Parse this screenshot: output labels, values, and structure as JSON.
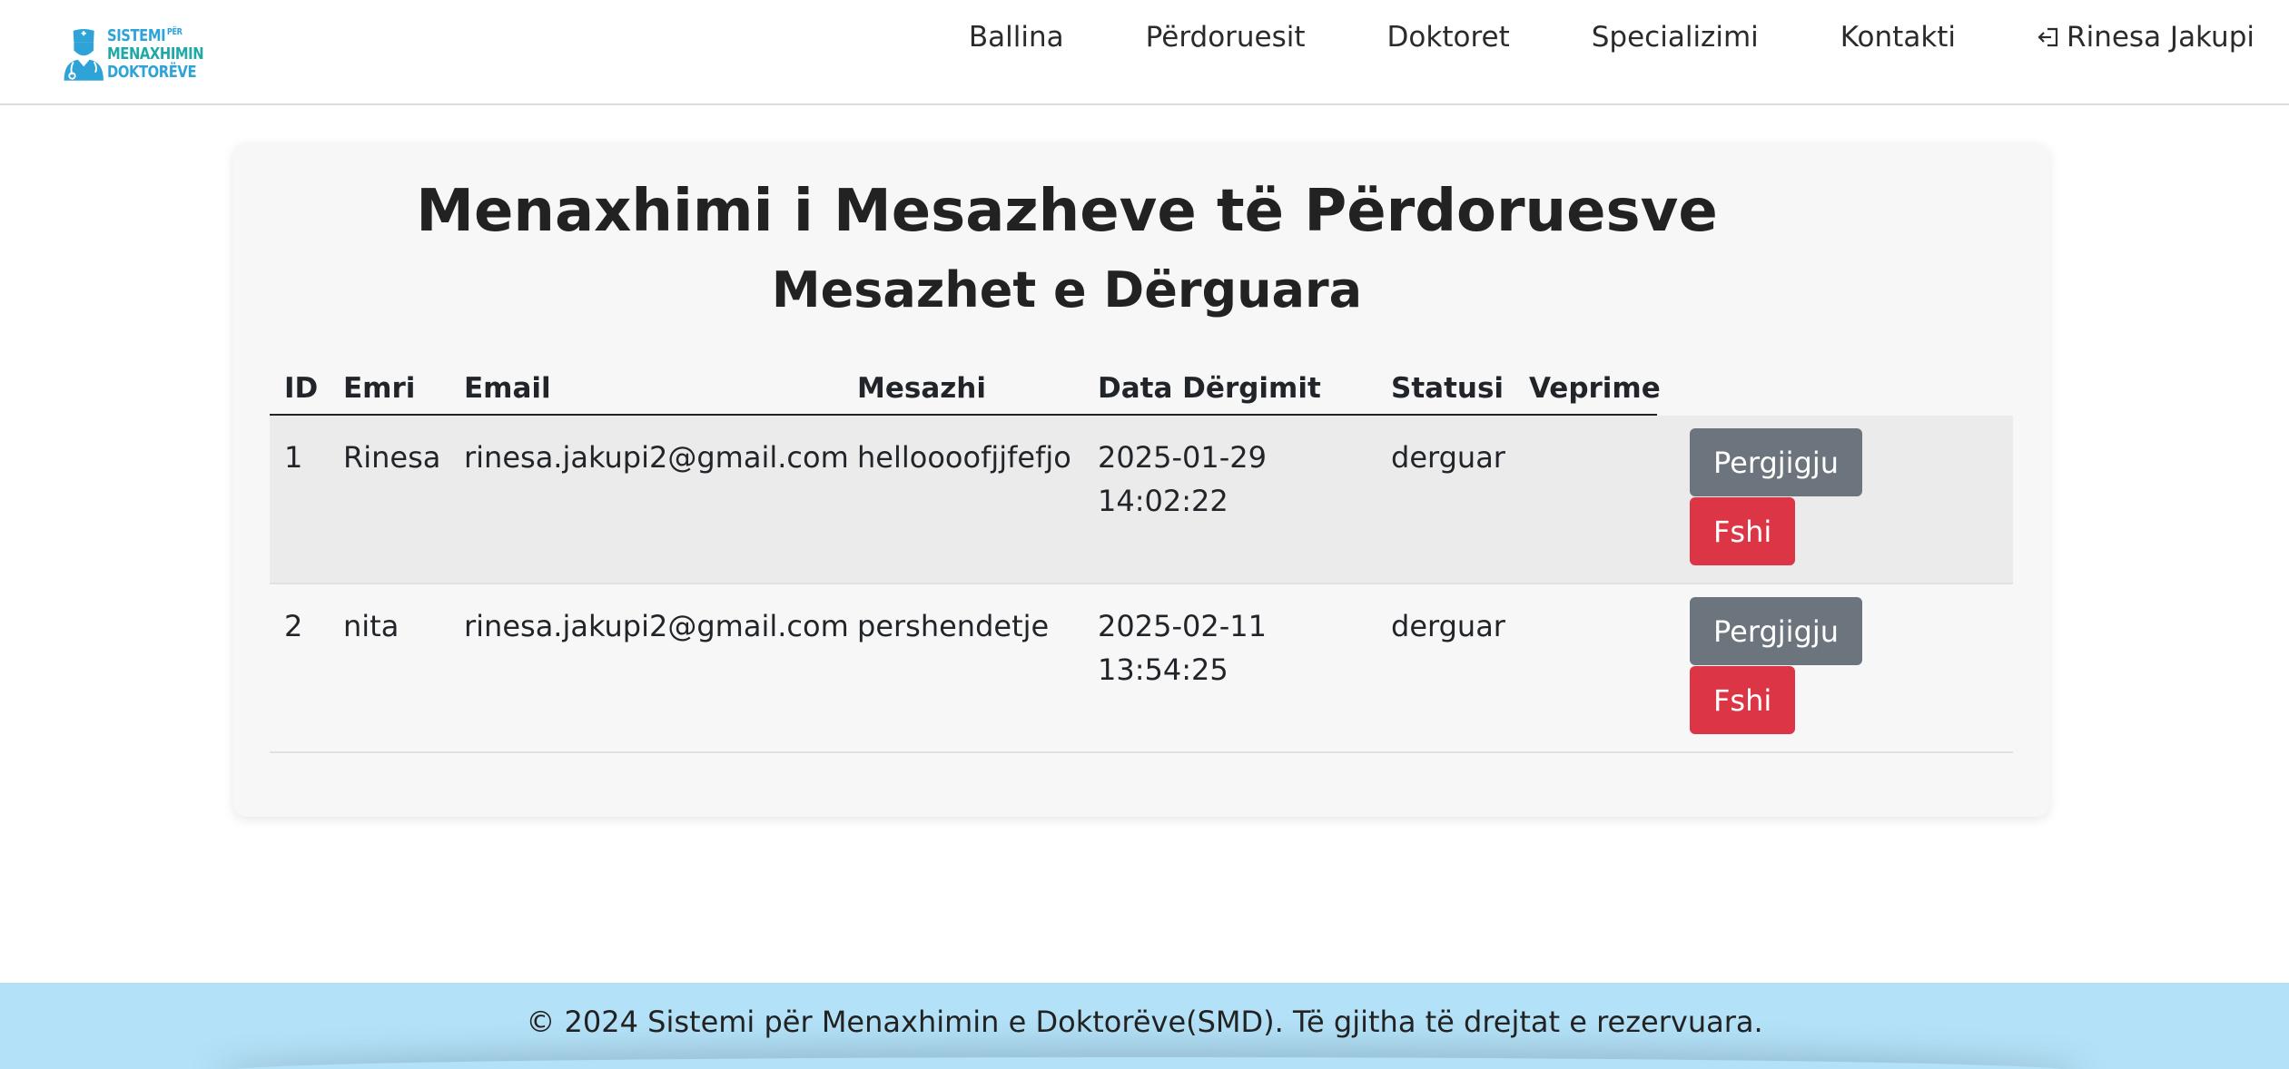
{
  "brand": {
    "line1": "SISTEMI",
    "line1_small": "PËR",
    "line2": "MENAXHIMIN",
    "line3": "DOKTORËVE",
    "icon": "doctor-avatar-icon",
    "colors": {
      "blue": "#2ea3d8",
      "teal": "#1ea9a8"
    }
  },
  "nav": {
    "items": [
      {
        "label": "Ballina"
      },
      {
        "label": "Përdoruesit"
      },
      {
        "label": "Doktoret"
      },
      {
        "label": "Specializimi"
      },
      {
        "label": "Kontakti"
      }
    ],
    "user": {
      "label": "Rinesa Jakupi",
      "icon": "logout-icon"
    }
  },
  "page": {
    "title": "Menaxhimi i Mesazheve të Përdoruesve",
    "section_title": "Mesazhet e Dërguara"
  },
  "table": {
    "headers": {
      "id": "ID",
      "name": "Emri",
      "email": "Email",
      "message": "Mesazhi",
      "date": "Data Dërgimit",
      "status": "Statusi",
      "actions": "Veprime"
    },
    "rows": [
      {
        "id": "1",
        "name": "Rinesa",
        "email": "rinesa.jakupi2@gmail.com",
        "message": "helloooofjjfefjo",
        "date": "2025-01-29",
        "time": "14:02:22",
        "status": "derguar",
        "reply_label": "Pergjigju",
        "delete_label": "Fshi"
      },
      {
        "id": "2",
        "name": "nita",
        "email": "rinesa.jakupi2@gmail.com",
        "message": "pershendetje",
        "date": "2025-02-11",
        "time": "13:54:25",
        "status": "derguar",
        "reply_label": "Pergjigju",
        "delete_label": "Fshi"
      }
    ]
  },
  "footer": {
    "text": "© 2024 Sistemi për Menaxhimin e Doktorëve(SMD). Të gjitha të drejtat e rezervuara."
  },
  "colors": {
    "reply_button": "#6c757d",
    "delete_button": "#dc3545",
    "footer_bg": "#b3e1f7"
  }
}
